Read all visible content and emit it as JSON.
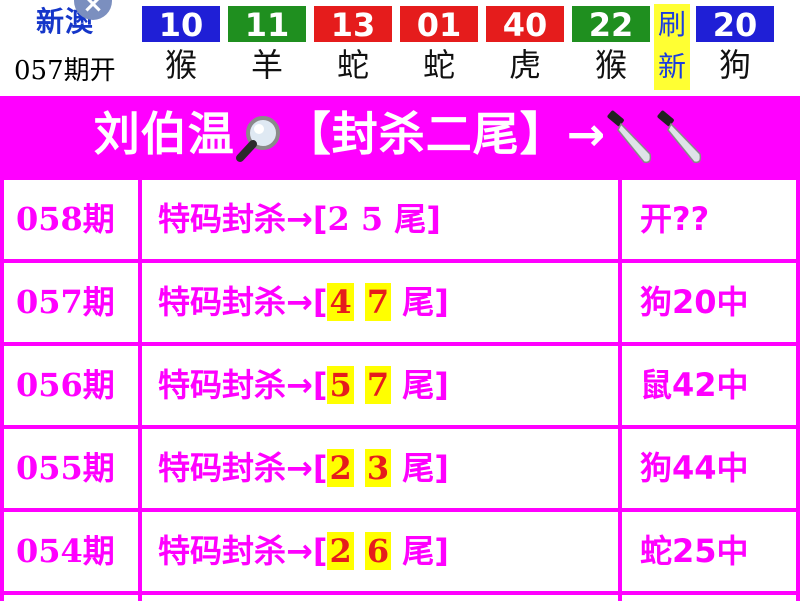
{
  "brand": {
    "title": "新澳",
    "close_symbol": "×",
    "period_label": "057期开"
  },
  "draw": [
    {
      "num": "10",
      "zodiac": "猴",
      "color": "blue"
    },
    {
      "num": "11",
      "zodiac": "羊",
      "color": "green"
    },
    {
      "num": "13",
      "zodiac": "蛇",
      "color": "red"
    },
    {
      "num": "01",
      "zodiac": "蛇",
      "color": "red"
    },
    {
      "num": "40",
      "zodiac": "虎",
      "color": "red"
    },
    {
      "num": "22",
      "zodiac": "猴",
      "color": "green"
    },
    {
      "num": "20",
      "zodiac": "狗",
      "color": "blue"
    }
  ],
  "refresh": {
    "line1": "刷",
    "line2": "新"
  },
  "header": {
    "name": "刘伯温",
    "tag": "【封杀二尾】→"
  },
  "rows": [
    {
      "period": "058期",
      "prefix": "特码封杀→[",
      "d1": "2",
      "d2": "5",
      "suffix": "尾]",
      "result": "开??",
      "highlight": false
    },
    {
      "period": "057期",
      "prefix": "特码封杀→[",
      "d1": "4",
      "d2": "7",
      "suffix": "尾]",
      "result": "狗20中",
      "highlight": true
    },
    {
      "period": "056期",
      "prefix": "特码封杀→[",
      "d1": "5",
      "d2": "7",
      "suffix": "尾]",
      "result": "鼠42中",
      "highlight": true
    },
    {
      "period": "055期",
      "prefix": "特码封杀→[",
      "d1": "2",
      "d2": "3",
      "suffix": "尾]",
      "result": "狗44中",
      "highlight": true
    },
    {
      "period": "054期",
      "prefix": "特码封杀→[",
      "d1": "2",
      "d2": "6",
      "suffix": "尾]",
      "result": "蛇25中",
      "highlight": true
    }
  ],
  "colors": {
    "magenta": "#ff00ff",
    "blue": "#1f1fd6",
    "green": "#1f8f1f",
    "red": "#e51c1c",
    "yellow": "#ffff00"
  },
  "icons": {
    "magnifier": "magnifier-icon",
    "knife": "knife-icon"
  }
}
